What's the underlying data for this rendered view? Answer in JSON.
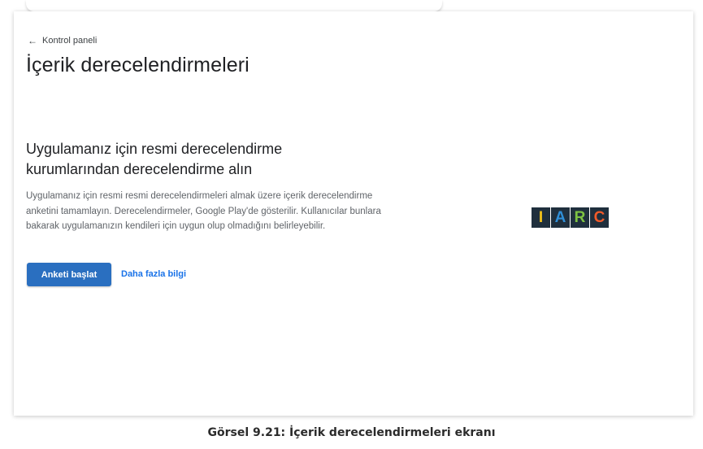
{
  "header": {
    "back_label": "Kontrol paneli",
    "title": "İçerik derecelendirmeleri"
  },
  "main": {
    "heading": "Uygulamanız için resmi derecelendirme kurumlarından derecelendirme alın",
    "description": "Uygulamanız için resmi resmi derecelendirmeleri almak üzere içerik derecelendirme anketini tamamlayın. Derecelendirmeler, Google Play'de gösterilir. Kullanıcılar bunlara bakarak uygulamanızın kendileri için uygun olup olmadığını belirleyebilir.",
    "start_button_label": "Anketi başlat",
    "learn_more_label": "Daha fazla bilgi"
  },
  "logo": {
    "letters": [
      {
        "char": "I",
        "color": "#f5c41a"
      },
      {
        "char": "A",
        "color": "#2f8fd8"
      },
      {
        "char": "R",
        "color": "#7dc242"
      },
      {
        "char": "C",
        "color": "#f15a29"
      }
    ]
  },
  "caption": "Görsel 9.21: İçerik derecelendirmeleri ekranı",
  "colors": {
    "primary_button": "#2a6fc0",
    "link": "#1a73e8",
    "title_text": "#202124",
    "body_text": "#5f6368"
  }
}
